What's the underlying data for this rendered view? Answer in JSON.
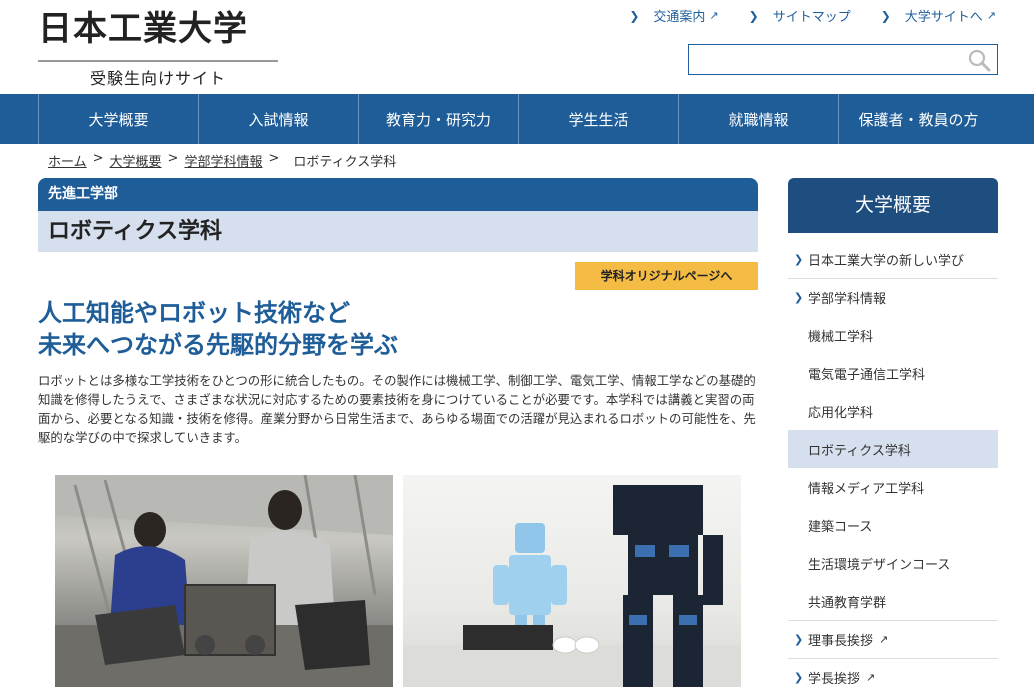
{
  "header": {
    "logo_main": "日本工業大学",
    "logo_sub": "受験生向けサイト",
    "util_links": [
      {
        "label": "交通案内",
        "external": true
      },
      {
        "label": "サイトマップ",
        "external": false
      },
      {
        "label": "大学サイトへ",
        "external": true
      }
    ],
    "search": {
      "placeholder": ""
    }
  },
  "gnav": {
    "items": [
      "大学概要",
      "入試情報",
      "教育力・研究力",
      "学生生活",
      "就職情報",
      "保護者・教員の方"
    ]
  },
  "breadcrumb": {
    "items": [
      "ホーム",
      "大学概要",
      "学部学科情報"
    ],
    "separator": ">",
    "current": "ロボティクス学科"
  },
  "main": {
    "dept": "先進工学部",
    "title": "ロボティクス学科",
    "orig_button": "学科オリジナルページへ",
    "headline_line1": "人工知能やロボット技術など",
    "headline_line2": "未来へつながる先駆的分野を学ぶ",
    "description": "ロボットとは多様な工学技術をひとつの形に統合したもの。その製作には機械工学、制御工学、電気工学、情報工学などの基礎的知識を修得したうえで、さまざまな状況に対応するための要素技術を身につけていることが必要です。本学科では講義と実習の両面から、必要となる知識・技術を修得。産業分野から日常生活まで、あらゆる場面での活躍が見込まれるロボットの可能性を、先駆的な学びの中で探求していきます。"
  },
  "sidebar": {
    "heading": "大学概要",
    "items": [
      {
        "label": "日本工業大学の新しい学び",
        "level": "main"
      },
      {
        "label": "学部学科情報",
        "level": "main"
      },
      {
        "label": "機械工学科",
        "level": "sub"
      },
      {
        "label": "電気電子通信工学科",
        "level": "sub"
      },
      {
        "label": "応用化学科",
        "level": "sub"
      },
      {
        "label": "ロボティクス学科",
        "level": "sub",
        "active": true
      },
      {
        "label": "情報メディア工学科",
        "level": "sub"
      },
      {
        "label": "建築コース",
        "level": "sub"
      },
      {
        "label": "生活環境デザインコース",
        "level": "sub"
      },
      {
        "label": "共通教育学群",
        "level": "sub"
      },
      {
        "label": "理事長挨拶",
        "level": "main",
        "external": true
      },
      {
        "label": "学長挨拶",
        "level": "main",
        "external": true
      }
    ]
  },
  "colors": {
    "brand_blue": "#1e5d98",
    "sidebar_head": "#1e4d80",
    "band_light": "#d6dfed",
    "accent_yellow": "#f4bc44"
  }
}
